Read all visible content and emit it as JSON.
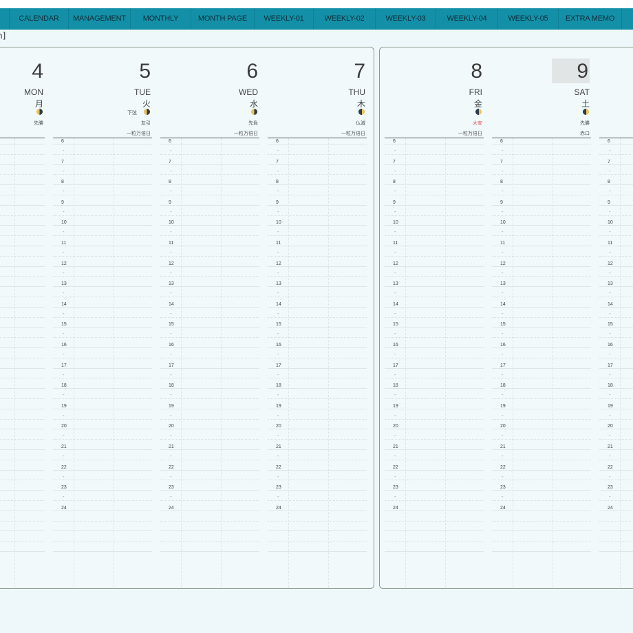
{
  "nav": {
    "tabs": [
      {
        "label": "CALENDAR"
      },
      {
        "label": "MANAGEMENT"
      },
      {
        "label": "MONTHLY"
      },
      {
        "label": "MONTH PAGE"
      },
      {
        "label": "WEEKLY-01"
      },
      {
        "label": "WEEKLY-02"
      },
      {
        "label": "WEEKLY-03"
      },
      {
        "label": "WEEKLY-04"
      },
      {
        "label": "WEEKLY-05"
      },
      {
        "label": "EXTRA MEMO"
      }
    ]
  },
  "fragment_label": "n]",
  "hours": [
    "6",
    "7",
    "8",
    "9",
    "10",
    "11",
    "12",
    "13",
    "14",
    "15",
    "16",
    "17",
    "18",
    "19",
    "20",
    "21",
    "22",
    "23",
    "24"
  ],
  "days": [
    {
      "num": "4",
      "name": "MON",
      "kanji": "月",
      "rokuyo": "先勝",
      "extra": "",
      "moon": "light",
      "highlight": false,
      "red": false
    },
    {
      "num": "5",
      "name": "TUE",
      "kanji": "火",
      "rokuyo": "友引",
      "extra": "一粒万倍日",
      "extra2": "下弦",
      "moon": "light",
      "highlight": false,
      "red": false
    },
    {
      "num": "6",
      "name": "WED",
      "kanji": "水",
      "rokuyo": "先負",
      "extra": "一粒万倍日",
      "moon": "light",
      "highlight": false,
      "red": false
    },
    {
      "num": "7",
      "name": "THU",
      "kanji": "木",
      "rokuyo": "仏滅",
      "extra": "一粒万倍日",
      "moon": "dark",
      "highlight": false,
      "red": false
    },
    {
      "num": "8",
      "name": "FRI",
      "kanji": "金",
      "rokuyo": "大安",
      "extra": "一粒万倍日",
      "moon": "dark",
      "highlight": false,
      "red": true
    },
    {
      "num": "9",
      "name": "SAT",
      "kanji": "土",
      "rokuyo": "先勝",
      "extra": "赤口",
      "moon": "dark",
      "highlight": true,
      "red": false
    }
  ]
}
